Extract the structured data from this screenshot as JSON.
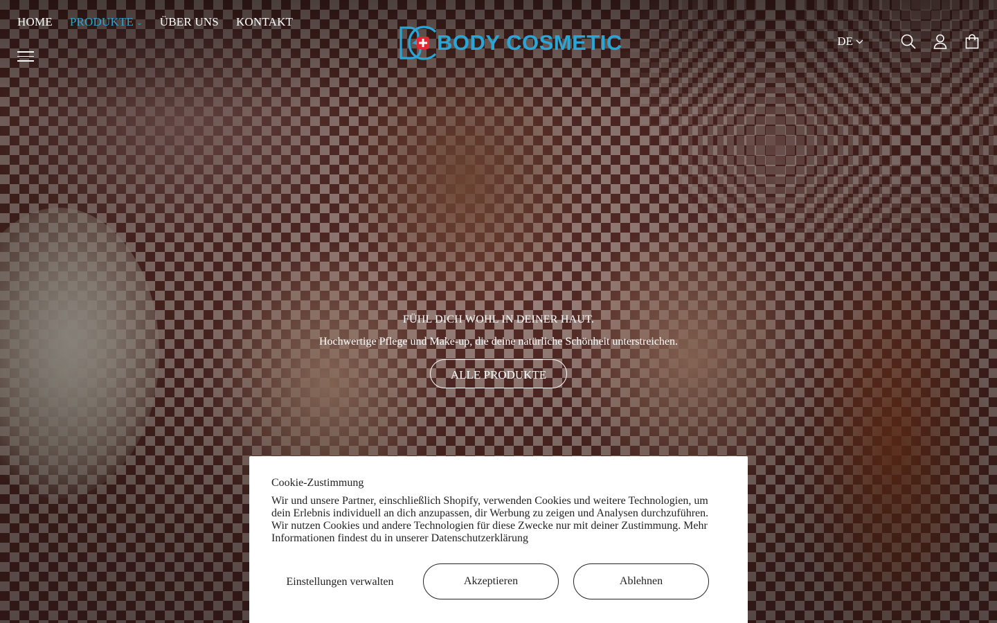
{
  "header": {
    "nav": [
      {
        "label": "HOME",
        "active": false
      },
      {
        "label": "PRODUKTE",
        "active": true,
        "has_dropdown": true
      },
      {
        "label": "ÜBER UNS",
        "active": false
      },
      {
        "label": "KONTAKT",
        "active": false
      }
    ],
    "logo_text": "BODY COSMETIC",
    "language": "DE",
    "icons": [
      "menu-icon",
      "search-icon",
      "account-icon",
      "cart-icon",
      "chevron-down-icon"
    ]
  },
  "hero": {
    "title": "FÜHL DICH WOHL IN DEINER HAUT.",
    "subtitle": "Hochwertige Pflege und Make-up, die deine natürliche Schönheit unterstreichen.",
    "button_label": "ALLE PRODUKTE"
  },
  "cookie_banner": {
    "title": "Cookie-Zustimmung",
    "text": "Wir und unsere Partner, einschließlich Shopify, verwenden Cookies und weitere Technologien, um dein Erlebnis individuell an dich anzupassen, dir Werbung zu zeigen und Analysen durchzuführen. Wir nutzen Cookies und andere Technologien für diese Zwecke nur mit deiner Zustimmung. Mehr Informationen findest du in unserer Datenschutzerklärung",
    "manage_label": "Einstellungen verwalten",
    "accept_label": "Akzeptieren",
    "decline_label": "Ablehnen"
  },
  "colors": {
    "accent": "#2aa6d6",
    "logo_red": "#e32630",
    "banner_bg": "#ffffff",
    "banner_text": "#222222"
  }
}
